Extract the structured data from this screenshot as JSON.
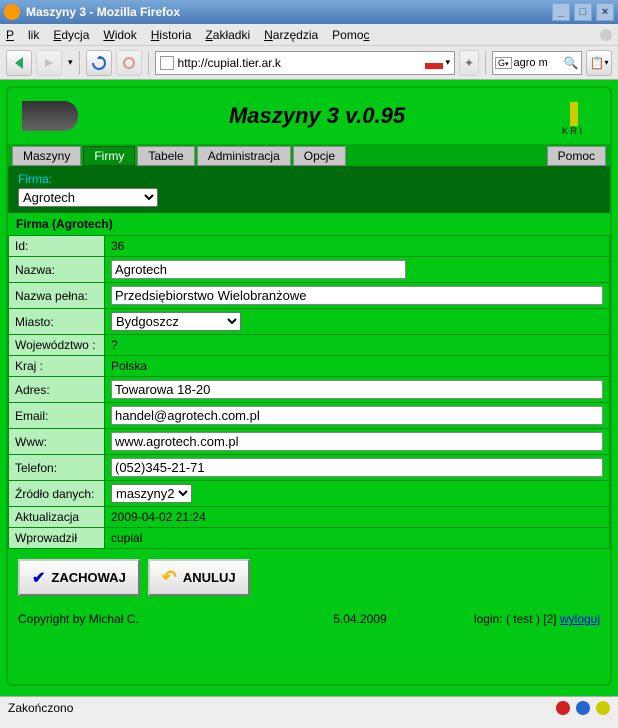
{
  "window": {
    "title": "Maszyny 3 - Mozilla Firefox"
  },
  "menu": {
    "file": "Plik",
    "edit": "Edycja",
    "view": "Widok",
    "history": "Historia",
    "bookmarks": "Zakładki",
    "tools": "Narzędzia",
    "help": "Pomoc"
  },
  "url": {
    "value": "http://cupial.tier.ar.k"
  },
  "search": {
    "value": "agro m"
  },
  "app": {
    "title": "Maszyny 3 v.0.95"
  },
  "tabs": {
    "t1": "Maszyny",
    "t2": "Firmy",
    "t3": "Tabele",
    "t4": "Administracja",
    "t5": "Opcje",
    "t6": "Pomoc"
  },
  "firmabar": {
    "label": "Firma:",
    "selected": "Agrotech"
  },
  "section": {
    "title_a": "Firma",
    "title_b": "(Agrotech)"
  },
  "form": {
    "id": {
      "label": "Id:",
      "value": "36"
    },
    "nazwa": {
      "label": "Nazwa:",
      "value": "Agrotech"
    },
    "nazwa_pelna": {
      "label": "Nazwa pełna:",
      "value": "Przedsiębiorstwo Wielobranżowe"
    },
    "miasto": {
      "label": "Miasto:",
      "value": "Bydgoszcz"
    },
    "woj": {
      "label": "Województwo :",
      "value": "?"
    },
    "kraj": {
      "label": "Kraj :",
      "value": "Polska"
    },
    "adres": {
      "label": "Adres:",
      "value": "Towarowa 18-20"
    },
    "email": {
      "label": "Email:",
      "value": "handel@agrotech.com.pl"
    },
    "www": {
      "label": "Www:",
      "value": "www.agrotech.com.pl"
    },
    "tel": {
      "label": "Telefon:",
      "value": "(052)345-21-71"
    },
    "zrodlo": {
      "label": "Źródło danych:",
      "value": "maszyny2"
    },
    "aktual": {
      "label": "Aktualizacja",
      "value": "2009-04-02 21:24"
    },
    "wpro": {
      "label": "Wprowadził",
      "value": "cupial"
    }
  },
  "buttons": {
    "save": "ZACHOWAJ",
    "cancel": "ANULUJ"
  },
  "footer": {
    "copyright": "Copyright by Michał C.",
    "date": "5.04.2009",
    "login_prefix": "login: ( test ) [2] ",
    "logout": "wyloguj"
  },
  "status": {
    "text": "Zakończono"
  }
}
